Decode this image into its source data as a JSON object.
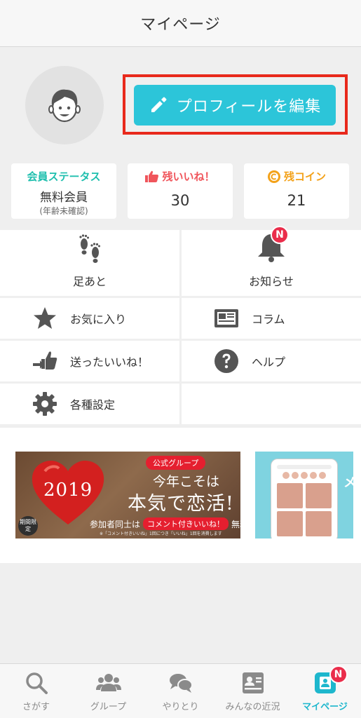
{
  "header": {
    "title": "マイページ"
  },
  "profile": {
    "edit_button_label": "プロフィールを編集"
  },
  "stats": {
    "member": {
      "title": "会員ステータス",
      "value": "無料会員",
      "sub": "(年齢未確認)"
    },
    "likes": {
      "title": "残いいね！",
      "value": "30"
    },
    "coins": {
      "title": "残コイン",
      "value": "21"
    }
  },
  "menu": {
    "footprints": "足あと",
    "notifications": "お知らせ",
    "notifications_badge": "N",
    "favorites": "お気に入り",
    "column": "コラム",
    "sent_likes": "送ったいいね！",
    "help": "ヘルプ",
    "settings": "各種設定"
  },
  "banner1": {
    "year": "2019",
    "limited": "期間限定",
    "tag": "公式グループ",
    "line1": "今年こそは",
    "line2": "本気で恋活!",
    "line3_prefix": "参加者同士は",
    "line3_comment": "コメント付きいいね！",
    "line3_suffix": "無料",
    "note": "※「コメント付きいいね」1回につき「いいね」1回を消費します"
  },
  "banner2": {
    "side_text": "メ"
  },
  "tabs": [
    {
      "label": "さがす",
      "icon": "search-icon"
    },
    {
      "label": "グループ",
      "icon": "group-icon"
    },
    {
      "label": "やりとり",
      "icon": "chat-icon"
    },
    {
      "label": "みんなの近況",
      "icon": "status-card-icon"
    },
    {
      "label": "マイページ",
      "icon": "mypage-icon",
      "badge": "N"
    }
  ],
  "colors": {
    "accent": "#2cc5d9",
    "highlight_frame": "#e8291c",
    "badge": "#ea2d4b",
    "active_tab": "#1eb7cd"
  }
}
